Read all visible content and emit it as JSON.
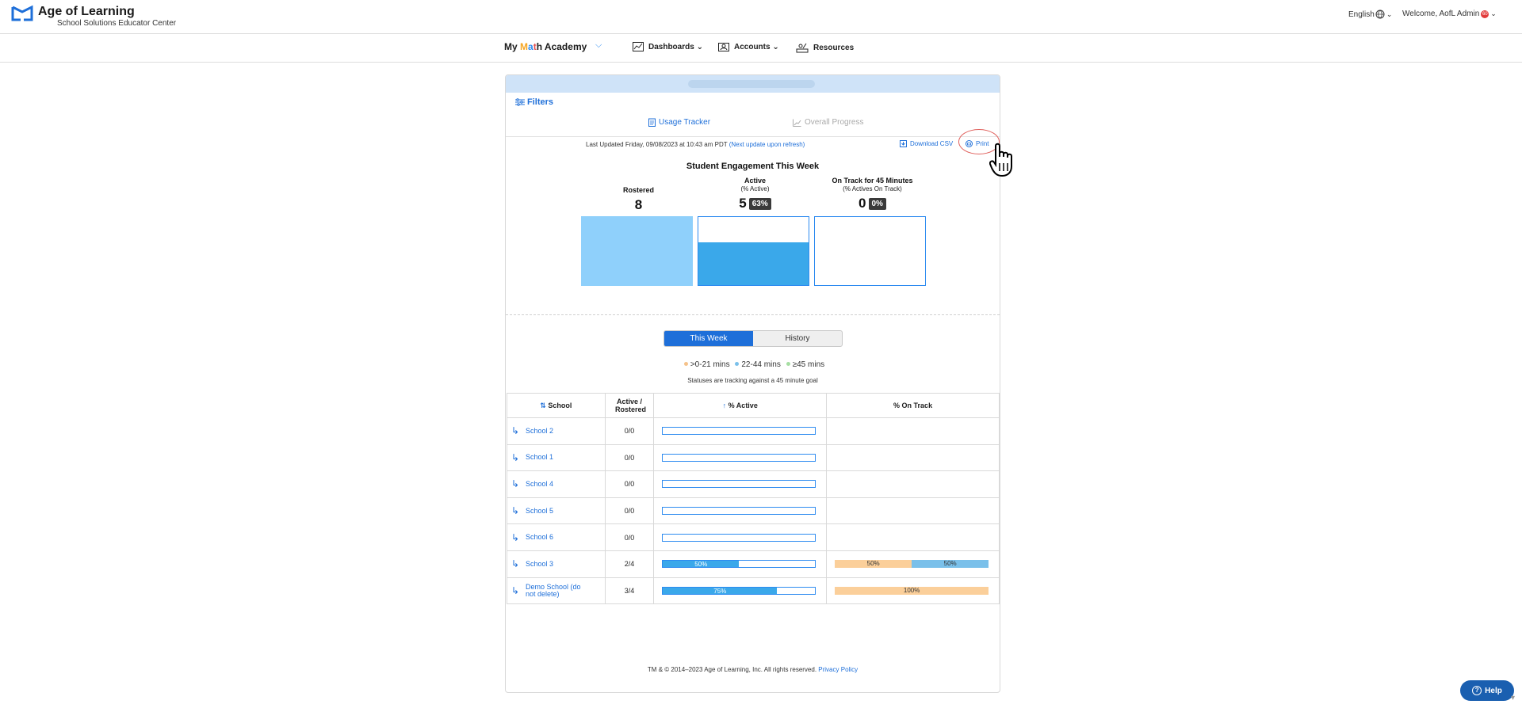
{
  "header": {
    "logo_name": "Age of Learning",
    "logo_sub": "School Solutions Educator Center",
    "language": "English",
    "welcome": "Welcome, AofL Admin",
    "notif_badge": "60"
  },
  "nav": {
    "product_prefix": "My ",
    "product_m": "M",
    "product_a": "a",
    "product_t": "t",
    "product_suffix": "h Academy",
    "items": [
      {
        "label": "Dashboards ⌄"
      },
      {
        "label": "Accounts ⌄"
      },
      {
        "label": "Resources"
      }
    ]
  },
  "card": {
    "filters_label": "Filters",
    "subtabs": {
      "usage": "Usage Tracker",
      "progress": "Overall Progress"
    },
    "updated_text": "Last Updated Friday, 09/08/2023 at 10:43 am PDT ",
    "updated_link": "(Next update upon refresh)",
    "download_csv": "Download CSV",
    "print": "Print",
    "engagement_title": "Student Engagement This Week",
    "metrics": [
      {
        "label": "Rostered",
        "sub": "",
        "value": "8",
        "badge": "",
        "fill_fraction": 1.0,
        "fill_color": "#8fd0fb"
      },
      {
        "label": "Active",
        "sub": "(% Active)",
        "value": "5",
        "badge": "63%",
        "fill_fraction": 0.625,
        "fill_color": "#3aa8ea"
      },
      {
        "label": "On Track for 45 Minutes",
        "sub": "(% Actives On Track)",
        "value": "0",
        "badge": "0%",
        "fill_fraction": 0.0,
        "fill_color": "#3aa8ea"
      }
    ],
    "toggle": {
      "this_week": "This Week",
      "history": "History"
    },
    "legend": [
      {
        "label": ">0-21 mins",
        "color": "#f5c28a"
      },
      {
        "label": "22-44 mins",
        "color": "#7ac0ea"
      },
      {
        "label": "≥45 mins",
        "color": "#a6dea2"
      }
    ],
    "goal_note": "Statuses are tracking against a 45 minute goal",
    "table": {
      "headers": {
        "school": "School",
        "ratio": "Active / Rostered",
        "active": "% Active",
        "ontrack": "% On Track"
      },
      "rows": [
        {
          "school": "School 2",
          "ratio": "0/0",
          "active_pct": 0,
          "active_label": "",
          "ontrack": []
        },
        {
          "school": "School 1",
          "ratio": "0/0",
          "active_pct": 0,
          "active_label": "",
          "ontrack": []
        },
        {
          "school": "School 4",
          "ratio": "0/0",
          "active_pct": 0,
          "active_label": "",
          "ontrack": []
        },
        {
          "school": "School 5",
          "ratio": "0/0",
          "active_pct": 0,
          "active_label": "",
          "ontrack": []
        },
        {
          "school": "School 6",
          "ratio": "0/0",
          "active_pct": 0,
          "active_label": "",
          "ontrack": []
        },
        {
          "school": "School 3",
          "ratio": "2/4",
          "active_pct": 50,
          "active_label": "50%",
          "ontrack": [
            {
              "pct": 50,
              "label": "50%",
              "color": "#fbcf9a"
            },
            {
              "pct": 50,
              "label": "50%",
              "color": "#7ac0ea"
            }
          ]
        },
        {
          "school": "Demo School (do not delete)",
          "ratio": "3/4",
          "active_pct": 75,
          "active_label": "75%",
          "ontrack": [
            {
              "pct": 100,
              "label": "100%",
              "color": "#fbcf9a"
            }
          ]
        }
      ]
    },
    "footer_text": "TM & © 2014–2023 Age of Learning, Inc. All rights reserved. ",
    "footer_link": "Privacy Policy"
  },
  "help": {
    "label": "Help",
    "q": "?"
  }
}
